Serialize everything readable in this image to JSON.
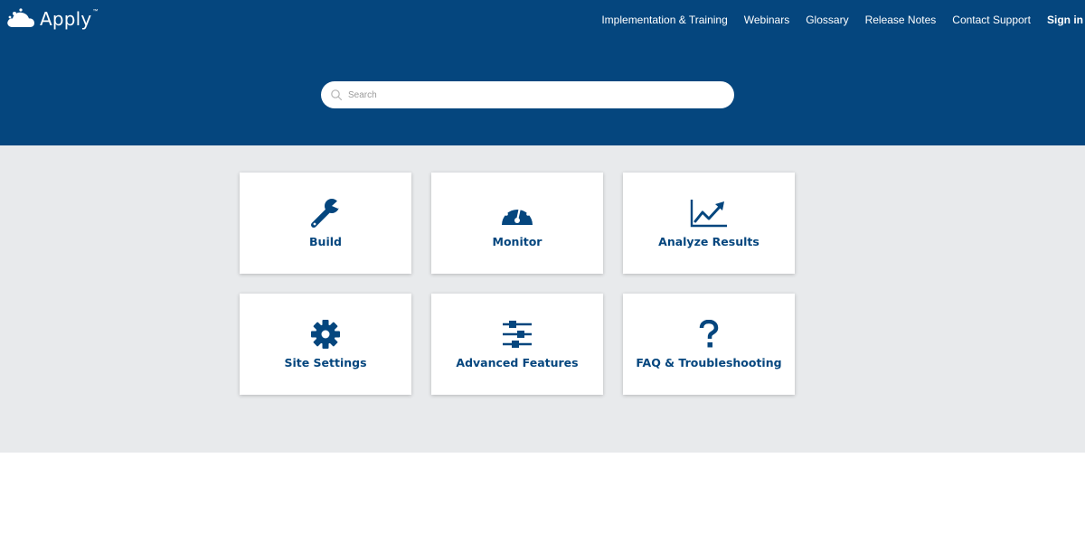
{
  "header": {
    "brand": "Apply",
    "brand_mark": "™",
    "nav": [
      "Implementation & Training",
      "Webinars",
      "Glossary",
      "Release Notes",
      "Contact Support"
    ],
    "signin_label": "Sign in",
    "background": "#05467e"
  },
  "search": {
    "placeholder": "Search",
    "icon": "search-icon"
  },
  "cards": [
    {
      "label": "Build",
      "icon": "wrench-icon"
    },
    {
      "label": "Monitor",
      "icon": "speedometer-icon"
    },
    {
      "label": "Analyze Results",
      "icon": "line-chart-icon"
    },
    {
      "label": "Site Settings",
      "icon": "gear-icon"
    },
    {
      "label": "Advanced Features",
      "icon": "sliders-icon"
    },
    {
      "label": "FAQ & Troubleshooting",
      "icon": "question-icon"
    }
  ],
  "colors": {
    "primary": "#05467e",
    "content_bg": "#e8eaec",
    "card_bg": "#ffffff"
  }
}
